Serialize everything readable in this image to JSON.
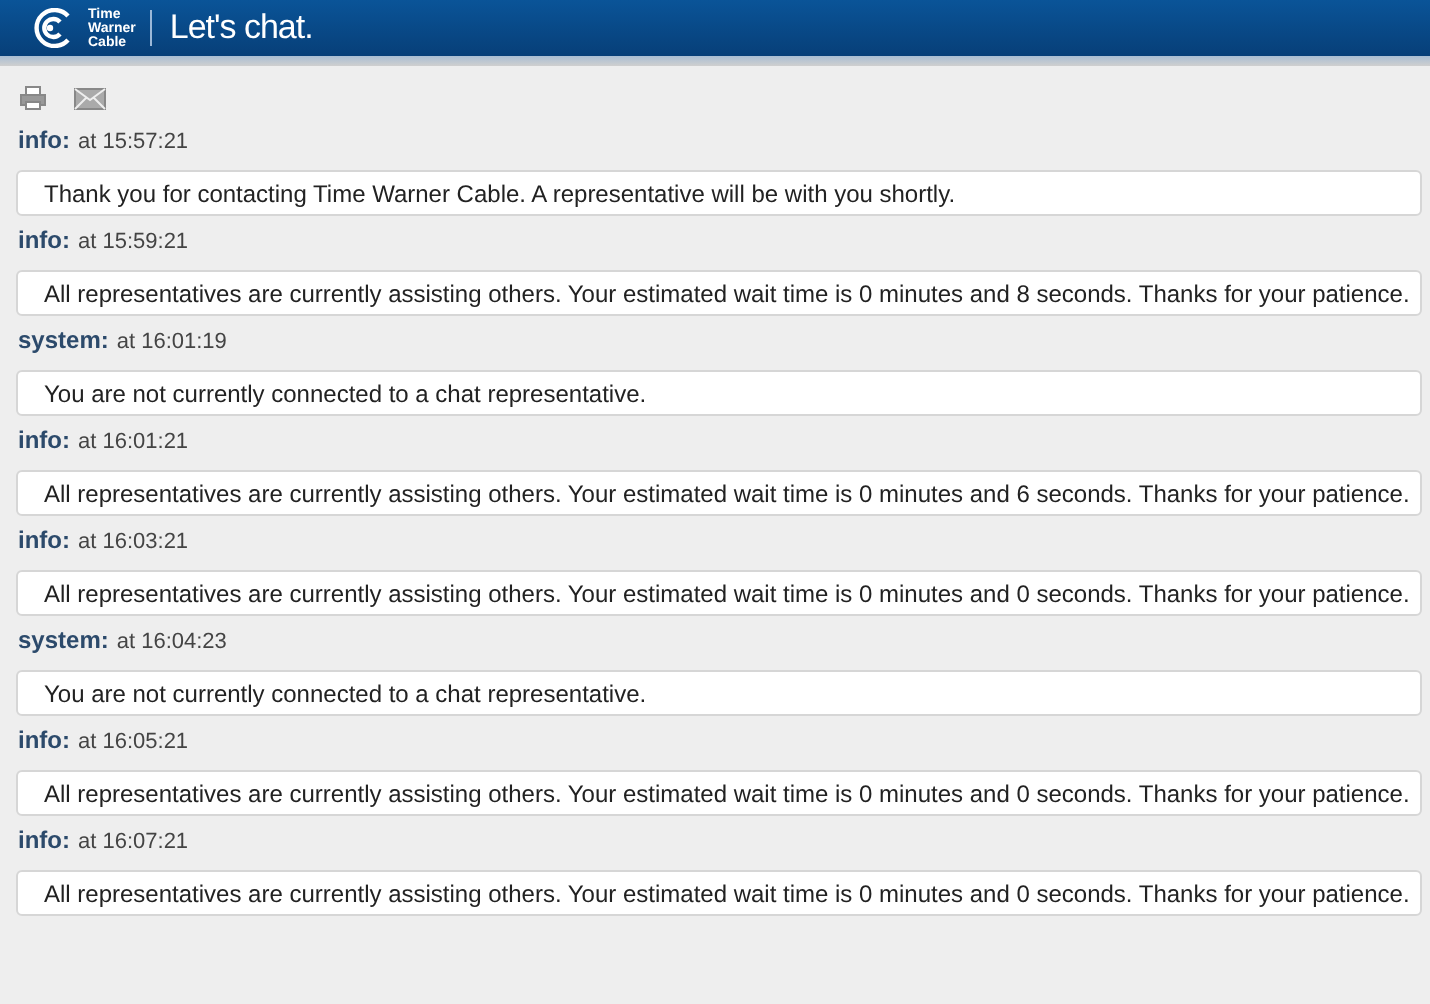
{
  "header": {
    "logo_text": [
      "Time",
      "Warner",
      "Cable"
    ],
    "title": "Let's chat."
  },
  "messages": [
    {
      "sender": "info:",
      "time": "at 15:57:21",
      "text": "Thank you for contacting Time Warner Cable. A representative will be with you shortly."
    },
    {
      "sender": "info:",
      "time": "at 15:59:21",
      "text": "All representatives are currently assisting others. Your estimated wait time is 0 minutes and 8 seconds. Thanks for your patience."
    },
    {
      "sender": "system:",
      "time": "at 16:01:19",
      "text": "You are not currently connected to a chat representative."
    },
    {
      "sender": "info:",
      "time": "at 16:01:21",
      "text": "All representatives are currently assisting others. Your estimated wait time is 0 minutes and 6 seconds. Thanks for your patience."
    },
    {
      "sender": "info:",
      "time": "at 16:03:21",
      "text": "All representatives are currently assisting others. Your estimated wait time is 0 minutes and 0 seconds. Thanks for your patience."
    },
    {
      "sender": "system:",
      "time": "at 16:04:23",
      "text": "You are not currently connected to a chat representative."
    },
    {
      "sender": "info:",
      "time": "at 16:05:21",
      "text": "All representatives are currently assisting others. Your estimated wait time is 0 minutes and 0 seconds. Thanks for your patience."
    },
    {
      "sender": "info:",
      "time": "at 16:07:21",
      "text": "All representatives are currently assisting others. Your estimated wait time is 0 minutes and 0 seconds. Thanks for your patience."
    }
  ]
}
